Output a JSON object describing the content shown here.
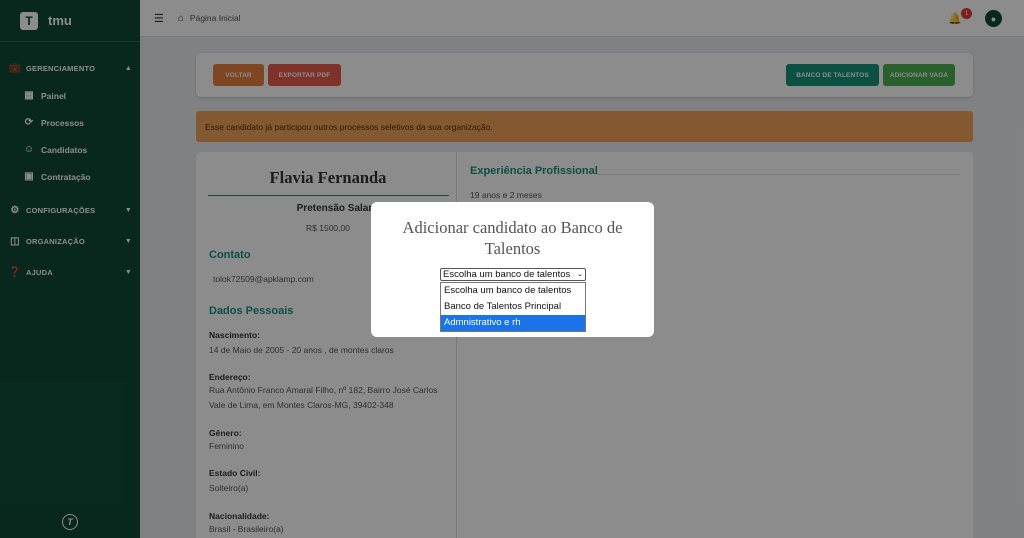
{
  "brand": {
    "logo_letter": "T",
    "name": "tmu"
  },
  "sidebar": {
    "sections": [
      {
        "label": "GERENCIAMENTO",
        "icon": "briefcase-icon",
        "items": [
          {
            "label": "Painel",
            "icon": "dashboard-icon"
          },
          {
            "label": "Processos",
            "icon": "process-icon"
          },
          {
            "label": "Candidatos",
            "icon": "users-icon"
          },
          {
            "label": "Contratação",
            "icon": "contract-icon"
          }
        ]
      },
      {
        "label": "CONFIGURAÇÕES",
        "icon": "gear-icon"
      },
      {
        "label": "ORGANIZAÇÃO",
        "icon": "building-icon"
      },
      {
        "label": "AJUDA",
        "icon": "help-icon"
      }
    ],
    "footer_logo": "T"
  },
  "topbar": {
    "breadcrumb": "Página Inicial",
    "notification_count": "1"
  },
  "toolbar": {
    "voltar": "VOLTAR",
    "exportar_pdf": "EXPORTAR PDF",
    "banco_talentos": "BANCO DE TALENTOS",
    "adicionar_vaga": "ADICIONAR VAGA"
  },
  "alert": {
    "text": "Esse candidato já participou outros processos seletivos da sua organização."
  },
  "profile": {
    "name": "Flavia Fernanda",
    "pretensao_label": "Pretensão Salarial",
    "pretensao_value": "R$ 1500,00",
    "contato_title": "Contato",
    "email": "tolok72509@apklamp.com",
    "dados_title": "Dados Pessoais",
    "nascimento_label": "Nascimento:",
    "nascimento_value": "14 de Maio de 2005 - 20 anos , de montes claros",
    "endereco_label": "Endereço:",
    "endereco_value": "Rua Antônio Franco Amaral Filho, nº 182, Bairro José Carlos Vale de Lima, em Montes Claros-MG, 39402-348",
    "genero_label": "Gênero:",
    "genero_value": "Feminino",
    "estado_civil_label": "Estado Civil:",
    "estado_civil_value": "Solteiro(a)",
    "nacionalidade_label": "Nacionalidade:",
    "nacionalidade_value": "Brasil - Brasileiro(a)"
  },
  "experience": {
    "title": "Experiência Profissional",
    "duration": "19 anos e 2 meses"
  },
  "modal": {
    "title": "Adicionar candidato ao Banco de Talentos",
    "select_value": "Escolha um banco de talentos",
    "options": [
      "Escolha um banco de talentos",
      "Banco de Talentos Principal",
      "Admnistrativo e rh"
    ],
    "highlighted_option": "Admnistrativo e rh"
  },
  "colors": {
    "sidebar_bg": "#0f4a36",
    "accent": "#17937b",
    "alert_bg": "#f0a05a",
    "highlight": "#1a73e8"
  }
}
